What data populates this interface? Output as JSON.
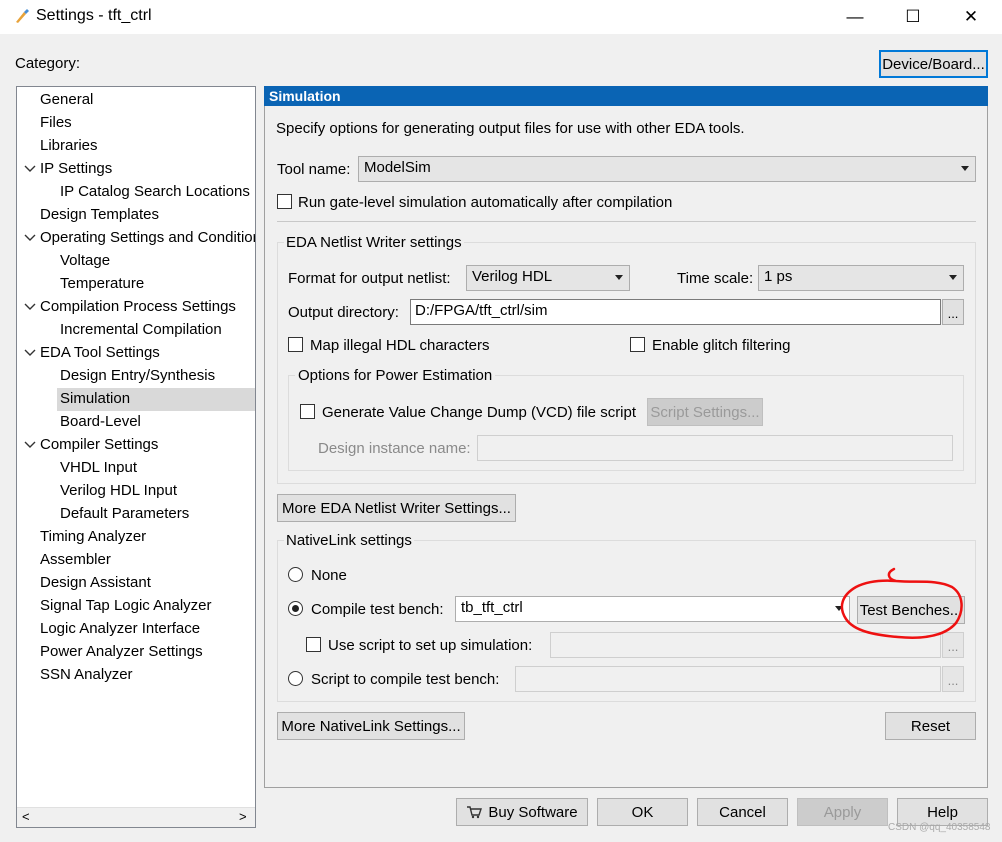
{
  "window": {
    "title": "Settings - tft_ctrl",
    "minimize_glyph": "—",
    "maximize_glyph": "☐",
    "close_glyph": "✕"
  },
  "category_label": "Category:",
  "device_board_button": "Device/Board...",
  "tree": [
    {
      "label": "General",
      "indent": 0,
      "expandable": false
    },
    {
      "label": "Files",
      "indent": 0,
      "expandable": false
    },
    {
      "label": "Libraries",
      "indent": 0,
      "expandable": false
    },
    {
      "label": "IP Settings",
      "indent": 0,
      "expandable": true
    },
    {
      "label": "IP Catalog Search Locations",
      "indent": 1,
      "expandable": false
    },
    {
      "label": "Design Templates",
      "indent": 0,
      "expandable": false
    },
    {
      "label": "Operating Settings and Conditions",
      "indent": 0,
      "expandable": true
    },
    {
      "label": "Voltage",
      "indent": 1,
      "expandable": false
    },
    {
      "label": "Temperature",
      "indent": 1,
      "expandable": false
    },
    {
      "label": "Compilation Process Settings",
      "indent": 0,
      "expandable": true
    },
    {
      "label": "Incremental Compilation",
      "indent": 1,
      "expandable": false
    },
    {
      "label": "EDA Tool Settings",
      "indent": 0,
      "expandable": true
    },
    {
      "label": "Design Entry/Synthesis",
      "indent": 1,
      "expandable": false
    },
    {
      "label": "Simulation",
      "indent": 1,
      "expandable": false,
      "selected": true
    },
    {
      "label": "Board-Level",
      "indent": 1,
      "expandable": false
    },
    {
      "label": "Compiler Settings",
      "indent": 0,
      "expandable": true
    },
    {
      "label": "VHDL Input",
      "indent": 1,
      "expandable": false
    },
    {
      "label": "Verilog HDL Input",
      "indent": 1,
      "expandable": false
    },
    {
      "label": "Default Parameters",
      "indent": 1,
      "expandable": false
    },
    {
      "label": "Timing Analyzer",
      "indent": 0,
      "expandable": false
    },
    {
      "label": "Assembler",
      "indent": 0,
      "expandable": false
    },
    {
      "label": "Design Assistant",
      "indent": 0,
      "expandable": false
    },
    {
      "label": "Signal Tap Logic Analyzer",
      "indent": 0,
      "expandable": false
    },
    {
      "label": "Logic Analyzer Interface",
      "indent": 0,
      "expandable": false
    },
    {
      "label": "Power Analyzer Settings",
      "indent": 0,
      "expandable": false
    },
    {
      "label": "SSN Analyzer",
      "indent": 0,
      "expandable": false
    }
  ],
  "scroll": {
    "left": "<",
    "right": ">"
  },
  "panel": {
    "header": "Simulation",
    "description": "Specify options for generating output files for use with other EDA tools.",
    "tool_name_label": "Tool name:",
    "tool_name_value": "ModelSim",
    "run_gate_level_label": "Run gate-level simulation automatically after compilation",
    "eda_netlist_group": "EDA Netlist Writer settings",
    "format_label": "Format for output netlist:",
    "format_value": "Verilog HDL",
    "time_scale_label": "Time scale:",
    "time_scale_value": "1 ps",
    "output_dir_label": "Output directory:",
    "output_dir_value": "D:/FPGA/tft_ctrl/sim",
    "browse_label": "...",
    "map_illegal_label": "Map illegal HDL characters",
    "glitch_label": "Enable glitch filtering",
    "power_group": "Options for Power Estimation",
    "vcd_label": "Generate Value Change Dump (VCD) file script",
    "script_settings_button": "Script Settings...",
    "design_instance_label": "Design instance name:",
    "design_instance_value": "",
    "more_eda_button": "More EDA Netlist Writer Settings...",
    "nativelink_group": "NativeLink settings",
    "none_label": "None",
    "compile_tb_label": "Compile test bench:",
    "compile_tb_value": "tb_tft_ctrl",
    "test_benches_button": "Test Benches...",
    "use_script_label": "Use script to set up simulation:",
    "use_script_value": "",
    "script_compile_label": "Script to compile test bench:",
    "script_compile_value": "",
    "more_nativelink_button": "More NativeLink Settings...",
    "reset_button": "Reset"
  },
  "footer": {
    "buy_software": "Buy Software",
    "ok": "OK",
    "cancel": "Cancel",
    "apply": "Apply",
    "help": "Help"
  },
  "watermark": "CSDN @qq_40358548",
  "colors": {
    "panel_header_bg": "#0a64b4",
    "annotation_red": "#ee1111",
    "focus_blue": "#0078d7"
  }
}
